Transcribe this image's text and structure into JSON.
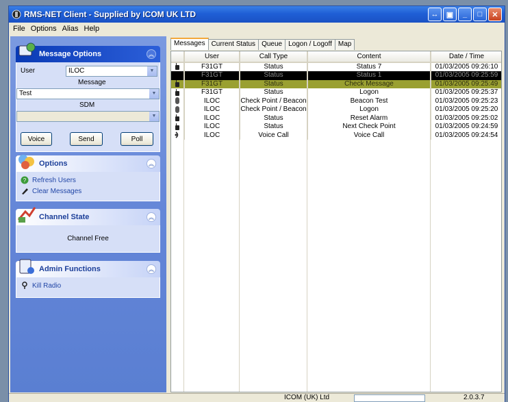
{
  "window": {
    "title": "RMS-NET Client - Supplied by ICOM UK LTD",
    "colors": {
      "titlebar": "#1f5fd6",
      "pane": "#6486d8",
      "selected_black": "#000000",
      "selected_olive": "#9aa031"
    }
  },
  "menu": [
    "File",
    "Options",
    "Alias",
    "Help"
  ],
  "message_options": {
    "title": "Message Options",
    "user_label": "User",
    "user_value": "ILOC",
    "message_label": "Message",
    "message_value": "Test",
    "sdm_label": "SDM",
    "sdm_value": "",
    "buttons": {
      "voice": "Voice",
      "send": "Send",
      "poll": "Poll"
    }
  },
  "options": {
    "title": "Options",
    "items": [
      {
        "label": "Refresh Users",
        "icon": "refresh-users-icon"
      },
      {
        "label": "Clear Messages",
        "icon": "clear-messages-icon"
      }
    ]
  },
  "channel_state": {
    "title": "Channel State",
    "value": "Channel Free"
  },
  "admin_functions": {
    "title": "Admin Functions",
    "items": [
      {
        "label": "Kill Radio",
        "icon": "kill-radio-icon"
      }
    ]
  },
  "tabs": [
    "Messages",
    "Current Status",
    "Queue",
    "Logon / Logoff",
    "Map"
  ],
  "table": {
    "columns": [
      "",
      "User",
      "Call Type",
      "Content",
      "Date / Time"
    ],
    "rows": [
      {
        "icon": "radio-icon",
        "user": "F31GT",
        "call_type": "Status",
        "content": "Status 7",
        "datetime": "01/03/2005 09:26:10",
        "style": ""
      },
      {
        "icon": "",
        "user": "F31GT",
        "call_type": "Status",
        "content": "Status 1",
        "datetime": "01/03/2005 09:25:59",
        "style": "sel-black"
      },
      {
        "icon": "radio-icon",
        "user": "F31GT",
        "call_type": "Status",
        "content": "Check Message",
        "datetime": "01/03/2005 09:25:49",
        "style": "sel-olive"
      },
      {
        "icon": "radio-icon",
        "user": "F31GT",
        "call_type": "Status",
        "content": "Logon",
        "datetime": "01/03/2005 09:25:37",
        "style": ""
      },
      {
        "icon": "beacon-icon",
        "user": "ILOC",
        "call_type": "Check Point / Beacon",
        "content": "Beacon Test",
        "datetime": "01/03/2005 09:25:23",
        "style": ""
      },
      {
        "icon": "beacon-icon",
        "user": "ILOC",
        "call_type": "Check Point / Beacon",
        "content": "Logon",
        "datetime": "01/03/2005 09:25:20",
        "style": ""
      },
      {
        "icon": "radio-icon",
        "user": "ILOC",
        "call_type": "Status",
        "content": "Reset Alarm",
        "datetime": "01/03/2005 09:25:02",
        "style": ""
      },
      {
        "icon": "radio-icon",
        "user": "ILOC",
        "call_type": "Status",
        "content": "Next Check Point",
        "datetime": "01/03/2005 09:24:59",
        "style": ""
      },
      {
        "icon": "voice-icon",
        "user": "ILOC",
        "call_type": "Voice Call",
        "content": "Voice Call",
        "datetime": "01/03/2005 09:24:54",
        "style": ""
      }
    ]
  },
  "status_bar": {
    "company": "ICOM (UK) Ltd",
    "version": "2.0.3.7"
  }
}
